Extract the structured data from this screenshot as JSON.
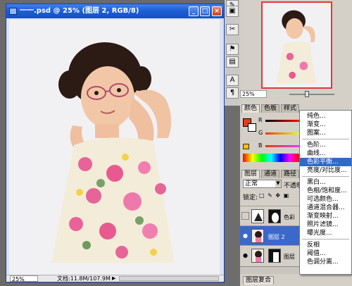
{
  "document": {
    "title": "一一.psd @ 25% (图层 2, RGB/8)",
    "zoom": "25%",
    "doc_info": "文档:11.8M/107.9M"
  },
  "navigator": {
    "zoom": "25%"
  },
  "panels": {
    "color_tabs": [
      "颜色",
      "色板",
      "样式"
    ],
    "color_sliders": [
      "R",
      "G",
      "B"
    ],
    "layers_tabs": [
      "图层",
      "通道",
      "路径"
    ],
    "blend_mode": "正常",
    "opacity_label": "不透明",
    "lock_label": "锁定:",
    "layers": [
      {
        "name": "色彩",
        "selected": false
      },
      {
        "name": "图层 2",
        "selected": true
      },
      {
        "name": "图层",
        "selected": false
      }
    ],
    "bottom_tab": "图层复合"
  },
  "context_menu": {
    "items": [
      {
        "label": "纯色...",
        "highlighted": false
      },
      {
        "label": "渐变...",
        "highlighted": false
      },
      {
        "label": "图案...",
        "highlighted": false
      },
      {
        "label": "色阶...",
        "highlighted": false
      },
      {
        "label": "曲线...",
        "highlighted": false
      },
      {
        "label": "色彩平衡...",
        "highlighted": true
      },
      {
        "label": "亮度/对比度...",
        "highlighted": false
      },
      {
        "label": "黑白...",
        "highlighted": false
      },
      {
        "label": "色相/饱和度...",
        "highlighted": false
      },
      {
        "label": "可选颜色...",
        "highlighted": false
      },
      {
        "label": "通道混合器...",
        "highlighted": false
      },
      {
        "label": "渐变映射...",
        "highlighted": false
      },
      {
        "label": "照片滤镜...",
        "highlighted": false
      },
      {
        "label": "曝光度...",
        "highlighted": false
      },
      {
        "label": "反相",
        "highlighted": false
      },
      {
        "label": "阈值...",
        "highlighted": false
      },
      {
        "label": "色调分离...",
        "highlighted": false
      }
    ]
  },
  "colors": {
    "title_blue": "#1e5fd6",
    "selection": "#316ac5",
    "foreground": "#e53b1a"
  }
}
